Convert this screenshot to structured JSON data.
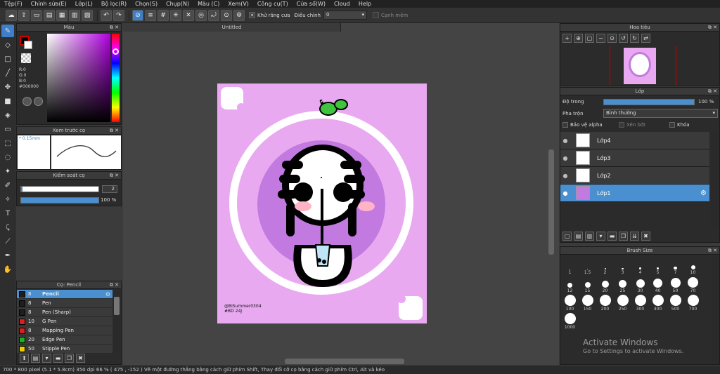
{
  "menu": [
    "Tệp(F)",
    "Chỉnh sửa(E)",
    "Lớp(L)",
    "Bộ lọc(R)",
    "Chọn(S)",
    "Chụp(N)",
    "Màu (C)",
    "Xem(V)",
    "Công cụ(T)",
    "Cửa sổ(W)",
    "Cloud",
    "Help"
  ],
  "toolbar": {
    "antialias_label": "Khử răng cưa",
    "adjust_label": "Điều chỉnh",
    "adjust_value": "0",
    "snap_label": "Cạnh mềm"
  },
  "color_panel": {
    "title": "Màu",
    "r": "R:0",
    "g": "G:0",
    "b": "B:0",
    "hex": "#000000"
  },
  "preview_panel": {
    "title": "Xem trước cọ",
    "size": "* 0.15mm"
  },
  "brush_control": {
    "title": "Kiểm soát cọ",
    "size_value": "2",
    "opacity_value": "100 %"
  },
  "brush_list": {
    "title": "Cọ: Pencil",
    "items": [
      {
        "size": "8",
        "name": "Pencil",
        "color": "#1e1e1e"
      },
      {
        "size": "8",
        "name": "Pen",
        "color": "#1e1e1e"
      },
      {
        "size": "8",
        "name": "Pen (Sharp)",
        "color": "#1e1e1e"
      },
      {
        "size": "10",
        "name": "G Pen",
        "color": "#d82020"
      },
      {
        "size": "8",
        "name": "Mapping Pen",
        "color": "#d82020"
      },
      {
        "size": "20",
        "name": "Edge Pen",
        "color": "#20b020"
      },
      {
        "size": "50",
        "name": "Stipple Pen",
        "color": "#e8d000"
      }
    ]
  },
  "document": {
    "tab": "Untitled",
    "signature": "@BiSummer0304\n#BD 24J"
  },
  "navigator": {
    "title": "Hoa tiêu"
  },
  "layer_panel": {
    "title": "Lớp",
    "opacity_label": "Độ trong",
    "opacity_value": "100 %",
    "blend_label": "Pha trộn",
    "blend_value": "Bình thường",
    "protect_alpha": "Bảo vệ alpha",
    "clip": "Xén bớt",
    "lock": "Khóa",
    "layers": [
      "Lớp4",
      "Lớp3",
      "Lớp2",
      "Lớp1"
    ]
  },
  "brush_size": {
    "title": "Brush Size",
    "sizes": [
      "1",
      "1.5",
      "2",
      "3",
      "4",
      "5",
      "7",
      "10",
      "12",
      "15",
      "20",
      "25",
      "30",
      "40",
      "50",
      "70",
      "100",
      "150",
      "200",
      "250",
      "300",
      "400",
      "500",
      "700",
      "1000"
    ]
  },
  "watermark": {
    "line1": "Activate Windows",
    "line2": "Go to Settings to activate Windows."
  },
  "status": "700 * 800 pixel   (5.1 * 5.8cm)   350 dpi   66 %   ( 475 , -152 )   Vẽ một đường thẳng bằng cách giữ phím Shift, Thay đổi cỡ cọ bằng cách giữ phím Ctrl, Alt và kéo",
  "colors": {
    "accent": "#4a90d0",
    "canvas_bg": "#e8a9f0",
    "circle": "#c27ae0",
    "leaf": "#3ec43e"
  }
}
